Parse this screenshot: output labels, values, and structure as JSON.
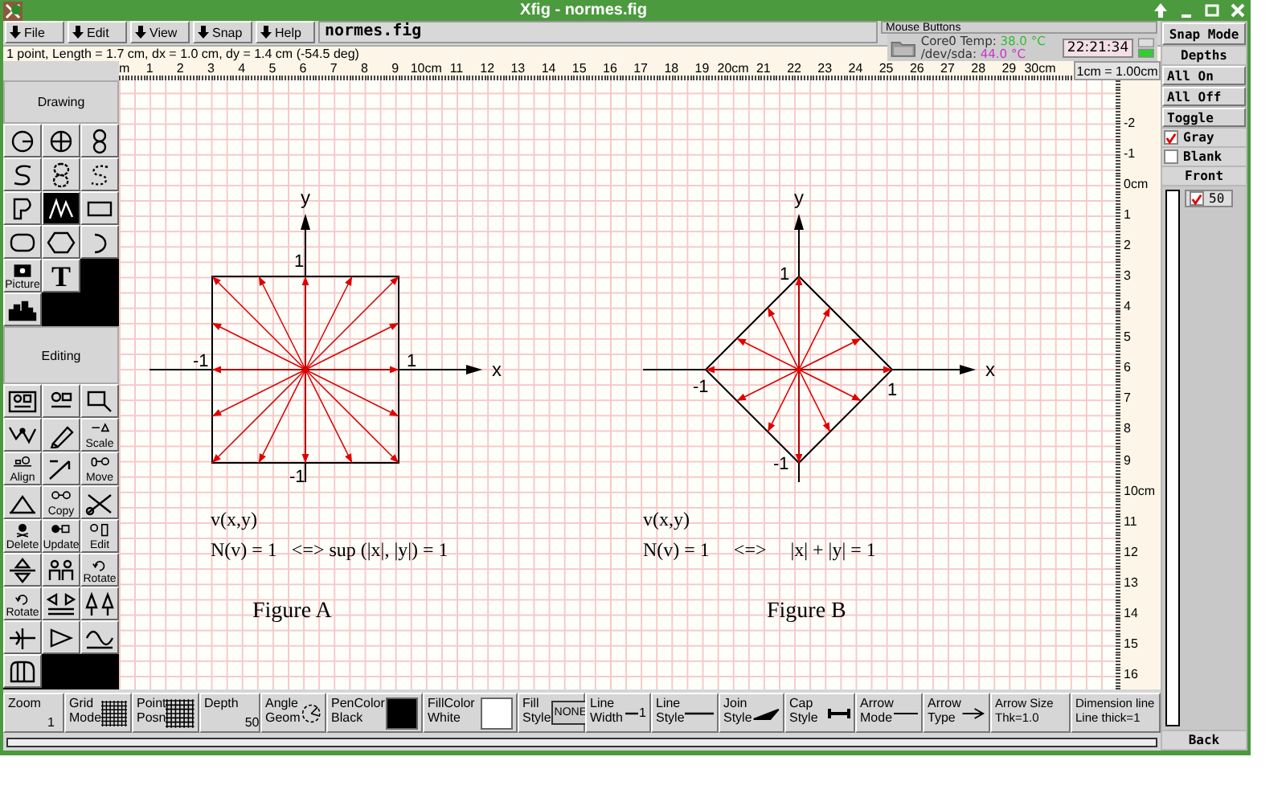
{
  "window": {
    "title": "Xfig - normes.fig"
  },
  "menu": [
    "File",
    "Edit",
    "View",
    "Snap",
    "Help"
  ],
  "filename": "normes.fig",
  "mouse_buttons": {
    "title": "Mouse Buttons"
  },
  "message": "1 point, Length = 1.7 cm, dx = 1.0 cm, dy = 1.4 cm (-54.5 deg)",
  "system_monitor": {
    "sensors": [
      {
        "label": "Core0 Temp:",
        "value": "38.0 °C",
        "color": "#33bb33"
      },
      {
        "label": "/dev/sda:",
        "value": "44.0 °C",
        "color": "#cc33cc"
      }
    ],
    "time": "22:21:34"
  },
  "ruler": {
    "unit_label": "1cm = 1.00cm",
    "top_marks": [
      "m",
      "1",
      "2",
      "3",
      "4",
      "5",
      "6",
      "7",
      "8",
      "9",
      "10cm",
      "11",
      "12",
      "13",
      "14",
      "15",
      "16",
      "17",
      "18",
      "19",
      "20cm",
      "21",
      "22",
      "23",
      "24",
      "25",
      "26",
      "27",
      "28",
      "29",
      "30cm"
    ],
    "side_marks": [
      "-2",
      "-1",
      "0cm",
      "1",
      "2",
      "3",
      "4",
      "5",
      "6",
      "7",
      "8",
      "9",
      "10cm",
      "11",
      "12",
      "13",
      "14",
      "15",
      "16"
    ]
  },
  "toolbox": {
    "drawing_title": "Drawing",
    "drawing_tools": [
      {
        "kind": "radius",
        "selected": false
      },
      {
        "kind": "diameter",
        "selected": false
      },
      {
        "kind": "ellipse",
        "selected": false
      },
      {
        "kind": "spline",
        "selected": false
      },
      {
        "kind": "closedspline",
        "selected": false
      },
      {
        "kind": "dottedspline",
        "selected": false
      },
      {
        "kind": "polygon",
        "selected": false
      },
      {
        "kind": "polyline",
        "selected": true
      },
      {
        "kind": "rectangle",
        "selected": false
      },
      {
        "kind": "roundbox",
        "selected": false
      },
      {
        "kind": "hexagon",
        "selected": false
      },
      {
        "kind": "arc",
        "selected": false
      },
      {
        "kind": "camera",
        "label": "Picture",
        "selected": false
      },
      {
        "kind": "letter",
        "label": "T",
        "selected": false
      },
      {
        "kind": "library",
        "selected": false
      }
    ],
    "editing_title": "Editing",
    "editing_tools": [
      {
        "kind": "glue",
        "selected": false
      },
      {
        "kind": "break",
        "selected": false
      },
      {
        "kind": "open",
        "selected": false
      },
      {
        "kind": "addpoint",
        "selected": false
      },
      {
        "kind": "pencil",
        "selected": false
      },
      {
        "kind": "scale",
        "label": "Scale",
        "selected": false
      },
      {
        "kind": "align",
        "label": "Align",
        "selected": false
      },
      {
        "kind": "editpoint",
        "selected": false
      },
      {
        "kind": "move",
        "label": "Move",
        "selected": false
      },
      {
        "kind": "arrowhead",
        "selected": false
      },
      {
        "kind": "copy",
        "label": "Copy",
        "selected": false
      },
      {
        "kind": "cut",
        "selected": false
      },
      {
        "kind": "delete",
        "label": "Delete",
        "selected": false
      },
      {
        "kind": "update",
        "label": "Update",
        "selected": false
      },
      {
        "kind": "edit",
        "label": "Edit",
        "selected": false
      },
      {
        "kind": "flipv",
        "selected": false
      },
      {
        "kind": "people",
        "selected": false
      },
      {
        "kind": "rotate",
        "label": "Rotate",
        "selected": false
      },
      {
        "kind": "rotate",
        "label": "Rotate",
        "selected": false
      },
      {
        "kind": "fliph",
        "selected": false
      },
      {
        "kind": "tree",
        "selected": false
      },
      {
        "kind": "dimension",
        "selected": false
      },
      {
        "kind": "triangle",
        "selected": false
      },
      {
        "kind": "wave",
        "selected": false
      },
      {
        "kind": "mouse",
        "selected": false
      }
    ]
  },
  "canvas": {
    "figures": [
      {
        "kind": "square",
        "axis_labels": {
          "x": "x",
          "y": "y"
        },
        "tick_labels": [
          "1",
          "-1",
          "1",
          "-1"
        ],
        "formula": [
          "v(x,y)",
          "N(v) = 1   <=> sup (|x|, |y|) = 1"
        ],
        "caption": "Figure A"
      },
      {
        "kind": "diamond",
        "axis_labels": {
          "x": "x",
          "y": "y"
        },
        "tick_labels": [
          "1",
          "-1",
          "1",
          "-1"
        ],
        "formula": [
          "v(x,y)",
          "N(v) = 1     <=>     |x| + |y| = 1"
        ],
        "caption": "Figure B"
      }
    ]
  },
  "indicators": [
    {
      "kind": "text",
      "label": "Zoom",
      "value": "1"
    },
    {
      "kind": "grid",
      "label": "Grid\nMode"
    },
    {
      "kind": "grid",
      "label": "Point\nPosn"
    },
    {
      "kind": "text",
      "label": "Depth",
      "value": "50"
    },
    {
      "kind": "angle",
      "label": "Angle\nGeom"
    },
    {
      "kind": "color",
      "label": "PenColor\nBlack",
      "color": "#000000"
    },
    {
      "kind": "color",
      "label": "FillColor\nWhite",
      "color": "#ffffff"
    },
    {
      "kind": "fillstyle",
      "label": "Fill\nStyle",
      "value": "NONE"
    },
    {
      "kind": "linewidth",
      "label": "Line\nWidth",
      "value": "1"
    },
    {
      "kind": "linestyle",
      "label": "Line\nStyle"
    },
    {
      "kind": "join",
      "label": "Join\nStyle"
    },
    {
      "kind": "cap",
      "label": "Cap\nStyle"
    },
    {
      "kind": "linestyle",
      "label": "Arrow\nMode"
    },
    {
      "kind": "arrowtype",
      "label": "Arrow\nType"
    },
    {
      "kind": "text2",
      "label": "Arrow Size",
      "value": "Thk=1.0"
    },
    {
      "kind": "text2",
      "label": "Dimension line",
      "value": "Line thick=1"
    }
  ],
  "side_panel": {
    "snap_mode": "Snap Mode",
    "depths": "Depths",
    "buttons": [
      "All On",
      "All Off",
      "Toggle"
    ],
    "options": [
      {
        "label": "Gray",
        "checked": true
      },
      {
        "label": "Blank",
        "checked": false
      }
    ],
    "front": "Front",
    "layers": [
      {
        "depth": "50",
        "checked": true
      }
    ],
    "back": "Back"
  }
}
